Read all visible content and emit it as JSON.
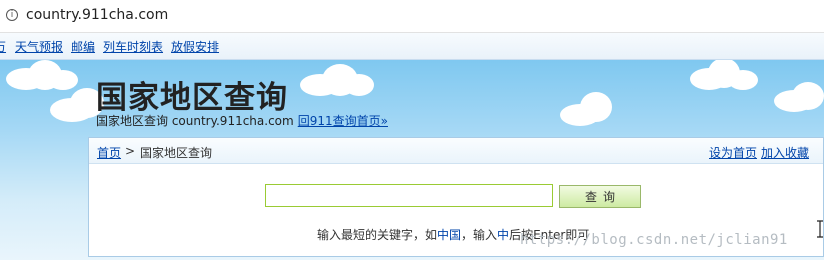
{
  "browser": {
    "url": "country.911cha.com",
    "info_icon": "info-icon"
  },
  "topnav": {
    "items": [
      "万",
      "天气预报",
      "邮编",
      "列车时刻表",
      "放假安排"
    ]
  },
  "header": {
    "title": "国家地区查询",
    "subtitle": "国家地区查询 country.911cha.com",
    "back_link": "回911查询首页»"
  },
  "breadcrumb": {
    "home": "首页",
    "separator": ">",
    "current": "国家地区查询",
    "set_home": "设为首页",
    "add_favorite": "加入收藏"
  },
  "search": {
    "value": "",
    "button_label": "查询"
  },
  "tip": {
    "before": "输入最短的关键字，如",
    "kw1": "中国",
    "middle": "，输入",
    "kw2": "中",
    "after": "后按Enter即可"
  },
  "watermark": "https://blog.csdn.net/jclian91",
  "colors": {
    "link": "#0044aa",
    "input_border": "#9acb34",
    "panel_border": "#a9cbe6"
  }
}
